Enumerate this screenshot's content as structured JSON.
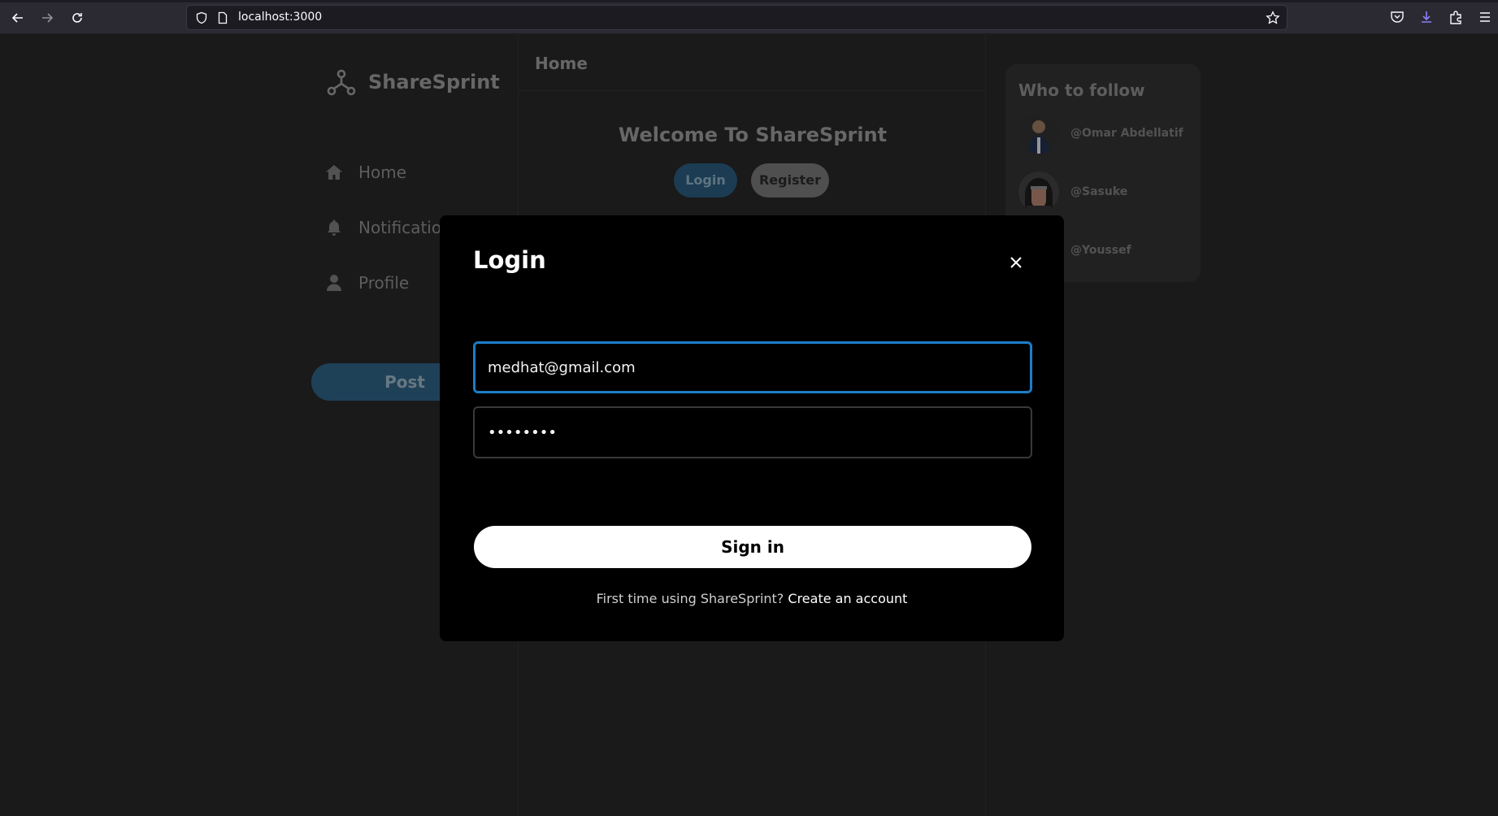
{
  "browser": {
    "url": "localhost:3000"
  },
  "brand": {
    "name": "ShareSprint"
  },
  "sidebar": {
    "items": [
      {
        "label": "Home",
        "icon": "home-icon"
      },
      {
        "label": "Notifications",
        "icon": "bell-icon"
      },
      {
        "label": "Profile",
        "icon": "user-icon"
      }
    ],
    "post_label": "Post"
  },
  "main": {
    "header": "Home",
    "welcome": "Welcome To ShareSprint",
    "login_label": "Login",
    "register_label": "Register"
  },
  "follow": {
    "title": "Who to follow",
    "users": [
      {
        "handle": "@Omar Abdellatif"
      },
      {
        "handle": "@Sasuke"
      },
      {
        "handle": "@Youssef"
      }
    ]
  },
  "modal": {
    "title": "Login",
    "email_value": "medhat@gmail.com",
    "password_value": "••••••••",
    "signin_label": "Sign in",
    "footer_text": "First time using ShareSprint?",
    "footer_link": "Create an account"
  },
  "colors": {
    "accent": "#1d7ec9",
    "post_button": "#2a5776",
    "background": "#232323"
  }
}
